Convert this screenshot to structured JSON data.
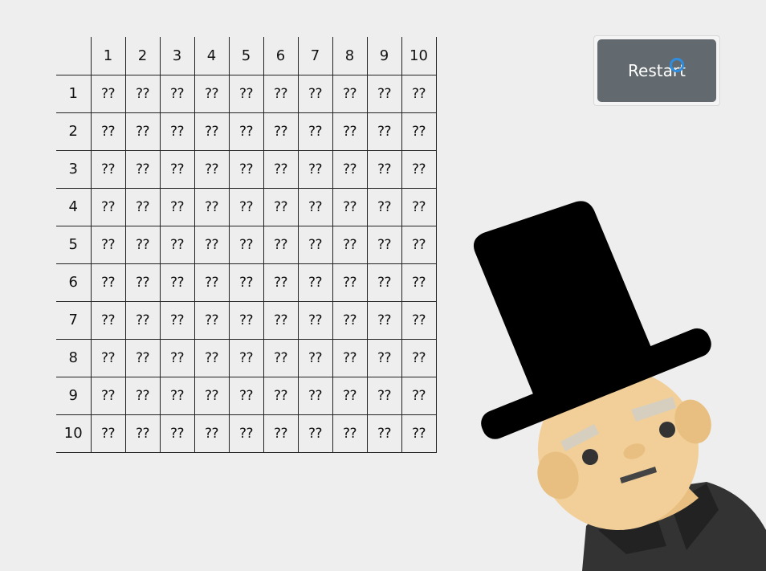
{
  "table": {
    "column_headers": [
      "1",
      "2",
      "3",
      "4",
      "5",
      "6",
      "7",
      "8",
      "9",
      "10"
    ],
    "row_headers": [
      "1",
      "2",
      "3",
      "4",
      "5",
      "6",
      "7",
      "8",
      "9",
      "10"
    ],
    "cell_value": "??"
  },
  "restart": {
    "label": "Restart"
  },
  "colors": {
    "background": "#eeeeee",
    "button": "#636a6f",
    "button_text": "#ffffff",
    "cursor": "#2f8de0",
    "hat": "#000000",
    "skin": "#f2cf98",
    "shirt": "#333333"
  },
  "icons": {
    "cursor": "loading-ring-icon",
    "character": "top-hat-character-icon"
  }
}
